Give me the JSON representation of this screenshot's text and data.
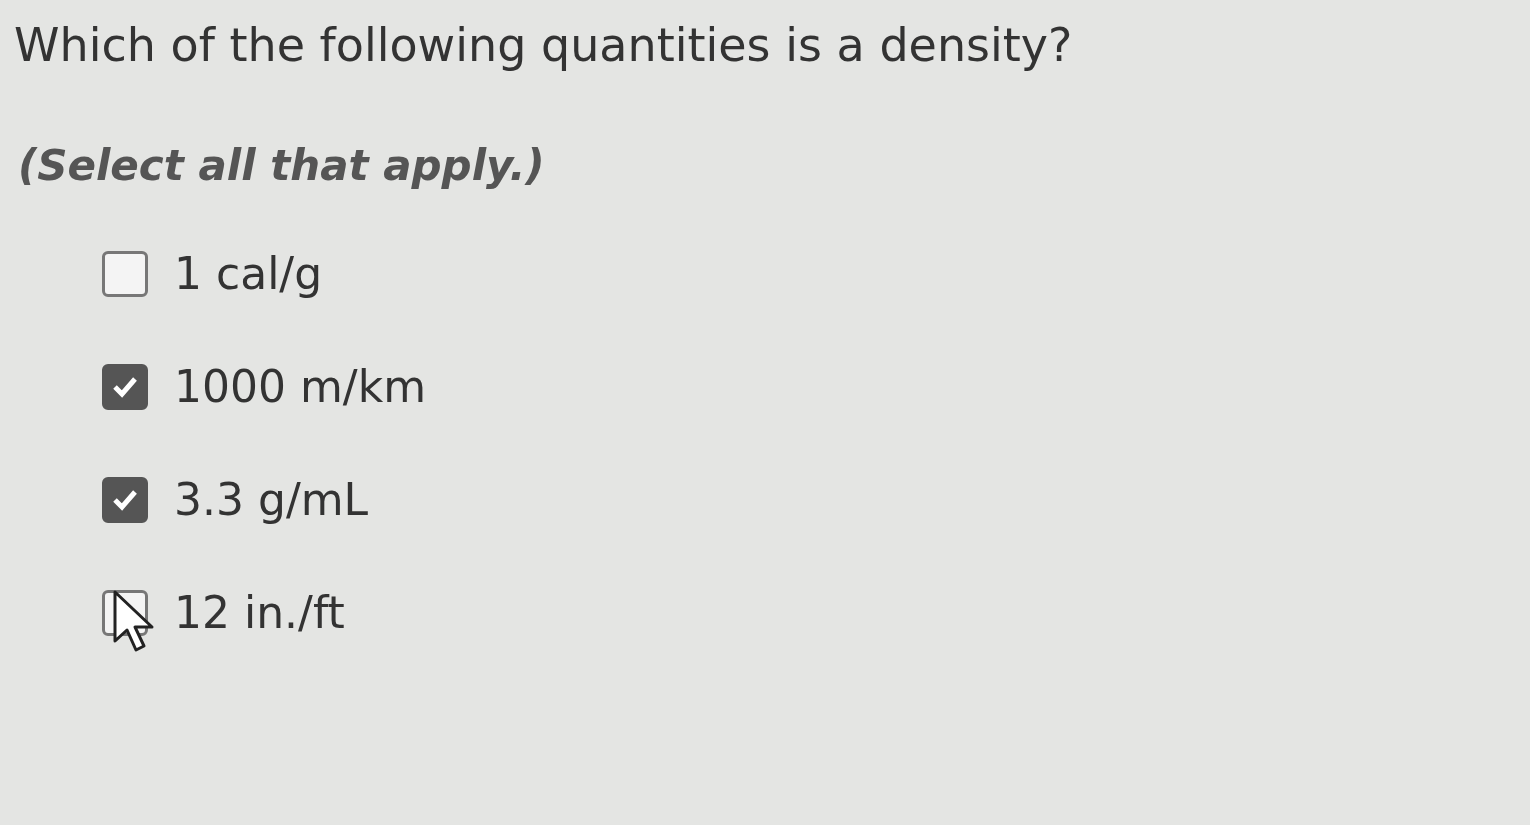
{
  "question": "Which of the following quantities is a density?",
  "instruction": "(Select all that apply.)",
  "options": [
    {
      "label": "1 cal/g",
      "checked": false
    },
    {
      "label": "1000 m/km",
      "checked": true
    },
    {
      "label": "3.3 g/mL",
      "checked": true
    },
    {
      "label": "12 in./ft",
      "checked": false
    }
  ]
}
